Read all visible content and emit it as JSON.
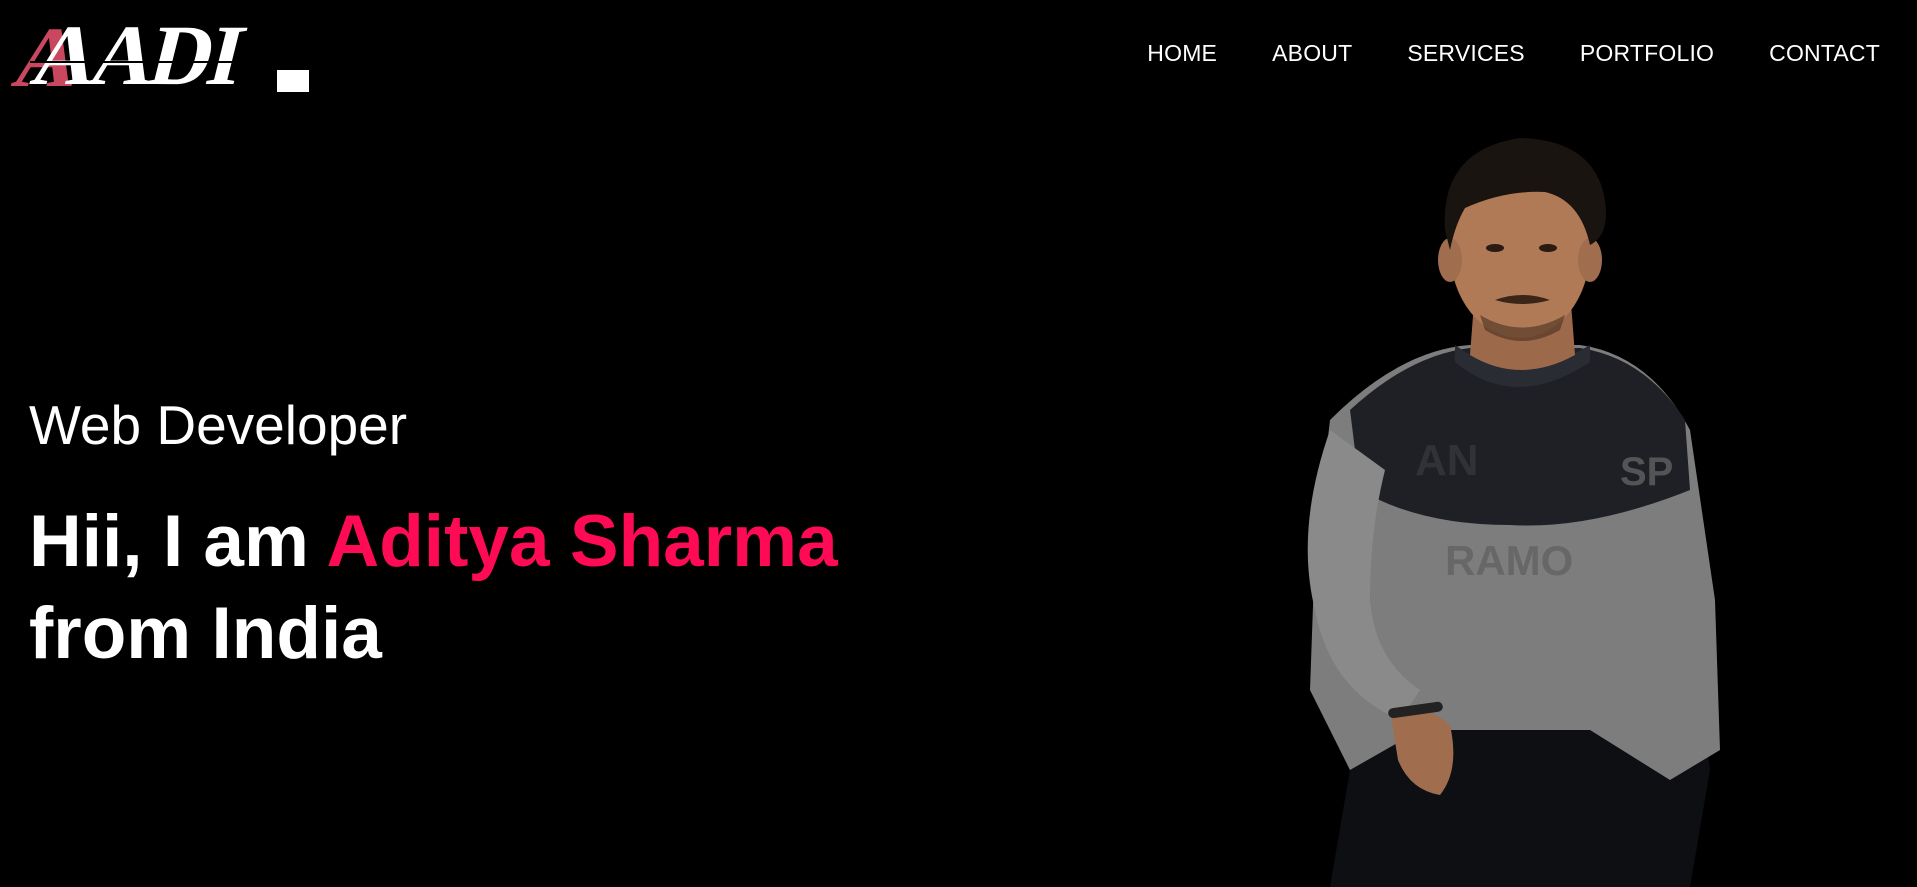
{
  "brand": {
    "logo_text": "AADI",
    "accent_color": "#ff0a54"
  },
  "nav": {
    "items": [
      {
        "label": "HOME"
      },
      {
        "label": "ABOUT"
      },
      {
        "label": "SERVICES"
      },
      {
        "label": "PORTFOLIO"
      },
      {
        "label": "CONTACT"
      }
    ]
  },
  "hero": {
    "role": "Web Developer",
    "greeting": "Hii, I am ",
    "name": "Aditya Sharma",
    "origin": "from India"
  },
  "portrait": {
    "icon": "person-photo"
  },
  "colors": {
    "background": "#000000",
    "text": "#ffffff",
    "accent": "#ff0a54",
    "sweater": "#7a7a7a",
    "sweater_dark": "#1e2026",
    "skin": "#b07a57",
    "hair": "#1a1411"
  }
}
